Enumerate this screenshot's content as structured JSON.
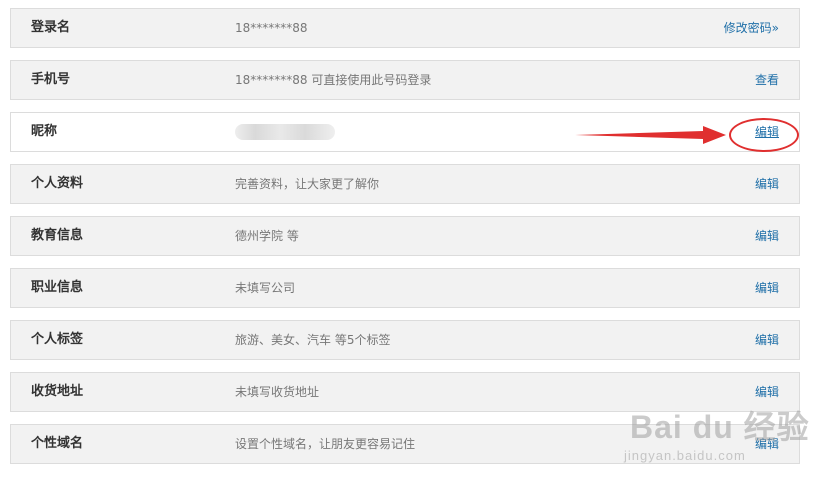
{
  "rows": [
    {
      "label": "登录名",
      "value": "18*******88",
      "action": "修改密码»"
    },
    {
      "label": "手机号",
      "value": "18*******88 可直接使用此号码登录",
      "action": "查看"
    },
    {
      "label": "昵称",
      "value": "",
      "action": "编辑"
    },
    {
      "label": "个人资料",
      "value": "完善资料，让大家更了解你",
      "action": "编辑"
    },
    {
      "label": "教育信息",
      "value": "德州学院 等",
      "action": "编辑"
    },
    {
      "label": "职业信息",
      "value": "未填写公司",
      "action": "编辑"
    },
    {
      "label": "个人标签",
      "value": "旅游、美女、汽车 等5个标签",
      "action": "编辑"
    },
    {
      "label": "收货地址",
      "value": "未填写收货地址",
      "action": "编辑"
    },
    {
      "label": "个性域名",
      "value": "设置个性域名，让朋友更容易记住",
      "action": "编辑"
    }
  ],
  "watermark": {
    "main": "Bai du 经验",
    "sub": "jingyan.baidu.com"
  },
  "colors": {
    "link": "#1f6fa8",
    "annotation": "#e02f2f",
    "row_bg": "#f2f2f2"
  }
}
